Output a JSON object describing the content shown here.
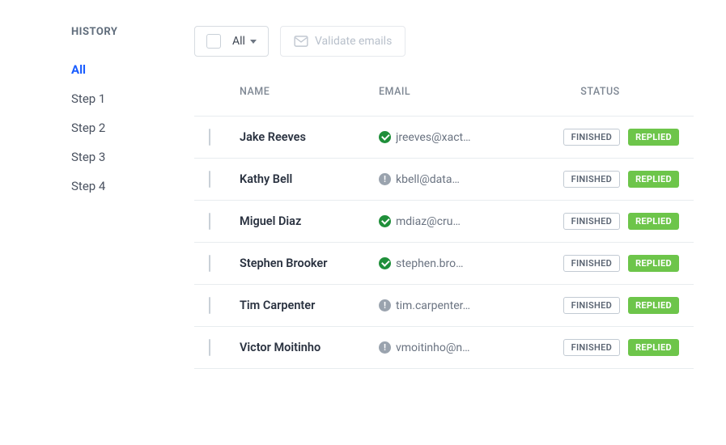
{
  "sidebar": {
    "title": "HISTORY",
    "items": [
      {
        "label": "All",
        "active": true
      },
      {
        "label": "Step 1",
        "active": false
      },
      {
        "label": "Step 2",
        "active": false
      },
      {
        "label": "Step 3",
        "active": false
      },
      {
        "label": "Step 4",
        "active": false
      }
    ]
  },
  "toolbar": {
    "filter_label": "All",
    "validate_label": "Validate emails"
  },
  "table": {
    "headers": {
      "name": "NAME",
      "email": "EMAIL",
      "status": "STATUS"
    },
    "rows": [
      {
        "name": "Jake Reeves",
        "email": "jreeves@xact…",
        "status_icon": "verified",
        "status1": "FINISHED",
        "status2": "REPLIED"
      },
      {
        "name": "Kathy Bell",
        "email": "kbell@data…",
        "status_icon": "unknown",
        "status1": "FINISHED",
        "status2": "REPLIED"
      },
      {
        "name": "Miguel Diaz",
        "email": "mdiaz@cru…",
        "status_icon": "verified",
        "status1": "FINISHED",
        "status2": "REPLIED"
      },
      {
        "name": "Stephen Brooker",
        "email": "stephen.bro…",
        "status_icon": "verified",
        "status1": "FINISHED",
        "status2": "REPLIED"
      },
      {
        "name": "Tim Carpenter",
        "email": "tim.carpenter…",
        "status_icon": "unknown",
        "status1": "FINISHED",
        "status2": "REPLIED"
      },
      {
        "name": "Victor Moitinho",
        "email": "vmoitinho@n…",
        "status_icon": "unknown",
        "status1": "FINISHED",
        "status2": "REPLIED"
      }
    ]
  }
}
